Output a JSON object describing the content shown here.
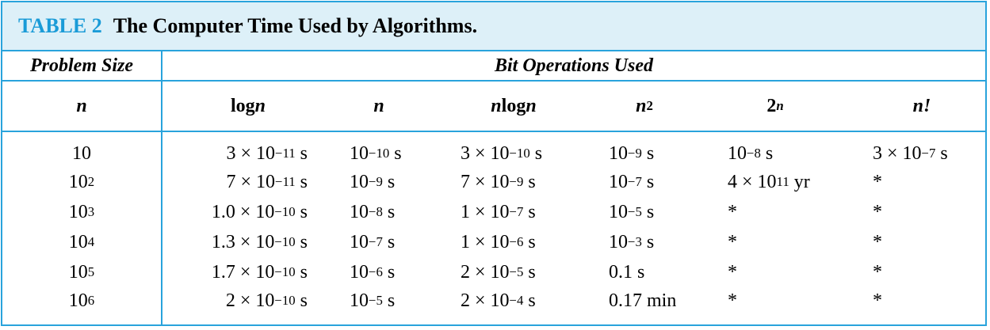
{
  "caption": {
    "label": "TABLE 2",
    "title": "The Computer Time Used by Algorithms."
  },
  "header": {
    "problem_size": "Problem Size",
    "bit_operations": "Bit Operations Used",
    "columns": [
      {
        "base": "n",
        "exp": ""
      },
      {
        "pre": "log ",
        "base": "n",
        "exp": ""
      },
      {
        "base": "n",
        "exp": ""
      },
      {
        "base": "n",
        "post": " log ",
        "base2": "n"
      },
      {
        "base": "n",
        "exp": "2"
      },
      {
        "base": "2",
        "exp": "n"
      },
      {
        "base": "n!",
        "exp": ""
      }
    ]
  },
  "rows": [
    {
      "n": {
        "b": "10",
        "e": ""
      },
      "log_n": {
        "m": "3 × ",
        "b": "10",
        "e": "−11",
        "u": " s"
      },
      "lin": {
        "m": "",
        "b": "10",
        "e": "−10",
        "u": " s"
      },
      "nlogn": {
        "m": "3 × ",
        "b": "10",
        "e": "−10",
        "u": " s"
      },
      "n2": {
        "m": "",
        "b": "10",
        "e": "−9",
        "u": " s"
      },
      "exp2": {
        "m": "",
        "b": "10",
        "e": "−8",
        "u": " s"
      },
      "fact": {
        "m": "3 × ",
        "b": "10",
        "e": "−7",
        "u": " s"
      }
    },
    {
      "n": {
        "b": "10",
        "e": "2"
      },
      "log_n": {
        "m": "7 × ",
        "b": "10",
        "e": "−11",
        "u": " s"
      },
      "lin": {
        "m": "",
        "b": "10",
        "e": "−9",
        "u": " s"
      },
      "nlogn": {
        "m": "7 × ",
        "b": "10",
        "e": "−9",
        "u": " s"
      },
      "n2": {
        "m": "",
        "b": "10",
        "e": "−7",
        "u": " s"
      },
      "exp2": {
        "m": "4 × ",
        "b": "10",
        "e": "11",
        "u": " yr"
      },
      "fact": {
        "m": "",
        "b": "*",
        "e": "",
        "u": ""
      }
    },
    {
      "n": {
        "b": "10",
        "e": "3"
      },
      "log_n": {
        "m": "1.0 × ",
        "b": "10",
        "e": "−10",
        "u": " s"
      },
      "lin": {
        "m": "",
        "b": "10",
        "e": "−8",
        "u": " s"
      },
      "nlogn": {
        "m": "1 × ",
        "b": "10",
        "e": "−7",
        "u": " s"
      },
      "n2": {
        "m": "",
        "b": "10",
        "e": "−5",
        "u": " s"
      },
      "exp2": {
        "m": "",
        "b": "*",
        "e": "",
        "u": ""
      },
      "fact": {
        "m": "",
        "b": "*",
        "e": "",
        "u": ""
      }
    },
    {
      "n": {
        "b": "10",
        "e": "4"
      },
      "log_n": {
        "m": "1.3 × ",
        "b": "10",
        "e": "−10",
        "u": " s"
      },
      "lin": {
        "m": "",
        "b": "10",
        "e": "−7",
        "u": " s"
      },
      "nlogn": {
        "m": "1 × ",
        "b": "10",
        "e": "−6",
        "u": " s"
      },
      "n2": {
        "m": "",
        "b": "10",
        "e": "−3",
        "u": " s"
      },
      "exp2": {
        "m": "",
        "b": "*",
        "e": "",
        "u": ""
      },
      "fact": {
        "m": "",
        "b": "*",
        "e": "",
        "u": ""
      }
    },
    {
      "n": {
        "b": "10",
        "e": "5"
      },
      "log_n": {
        "m": "1.7 × ",
        "b": "10",
        "e": "−10",
        "u": " s"
      },
      "lin": {
        "m": "",
        "b": "10",
        "e": "−6",
        "u": " s"
      },
      "nlogn": {
        "m": "2 × ",
        "b": "10",
        "e": "−5",
        "u": " s"
      },
      "n2": {
        "m": "",
        "b": "0.1 s",
        "e": "",
        "u": ""
      },
      "exp2": {
        "m": "",
        "b": "*",
        "e": "",
        "u": ""
      },
      "fact": {
        "m": "",
        "b": "*",
        "e": "",
        "u": ""
      }
    },
    {
      "n": {
        "b": "10",
        "e": "6"
      },
      "log_n": {
        "m": "2 × ",
        "b": "10",
        "e": "−10",
        "u": " s"
      },
      "lin": {
        "m": "",
        "b": "10",
        "e": "−5",
        "u": " s"
      },
      "nlogn": {
        "m": "2 × ",
        "b": "10",
        "e": "−4",
        "u": " s"
      },
      "n2": {
        "m": "",
        "b": "0.17 min",
        "e": "",
        "u": ""
      },
      "exp2": {
        "m": "",
        "b": "*",
        "e": "",
        "u": ""
      },
      "fact": {
        "m": "",
        "b": "*",
        "e": "",
        "u": ""
      }
    }
  ],
  "colors": {
    "accent": "#29a3dc",
    "caption_label": "#1a9bd7",
    "caption_bg": "#ddf0f8"
  }
}
